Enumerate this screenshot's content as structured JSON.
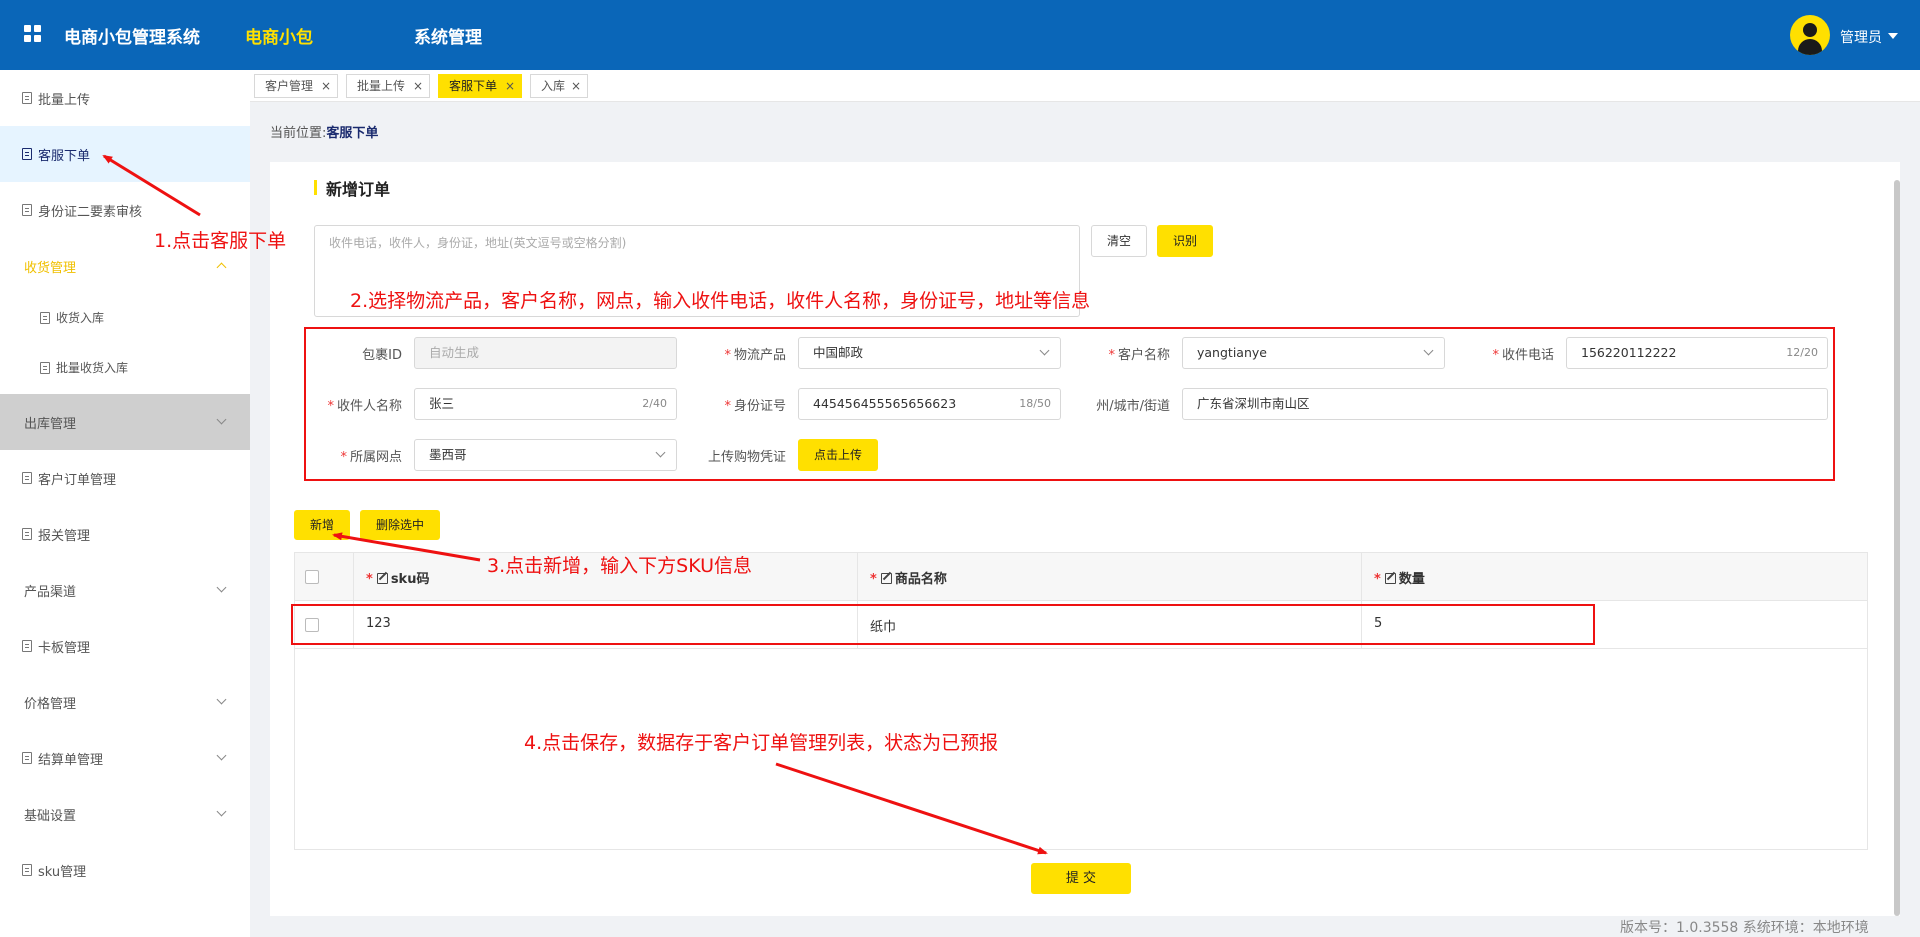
{
  "header": {
    "brand": "电商小包管理系统",
    "nav": [
      {
        "label": "电商小包",
        "active": true
      },
      {
        "label": "系统管理",
        "active": false
      }
    ],
    "user": "管理员"
  },
  "sidebar": {
    "items": [
      {
        "label": "批量上传"
      },
      {
        "label": "客服下单"
      },
      {
        "label": "身份证二要素审核"
      },
      {
        "label": "收货管理"
      },
      {
        "label": "收货入库"
      },
      {
        "label": "批量收货入库"
      },
      {
        "label": "出库管理"
      },
      {
        "label": "客户订单管理"
      },
      {
        "label": "报关管理"
      },
      {
        "label": "产品渠道"
      },
      {
        "label": "卡板管理"
      },
      {
        "label": "价格管理"
      },
      {
        "label": "结算单管理"
      },
      {
        "label": "基础设置"
      },
      {
        "label": "sku管理"
      }
    ]
  },
  "tabs": [
    {
      "label": "客户管理"
    },
    {
      "label": "批量上传"
    },
    {
      "label": "客服下单"
    },
    {
      "label": "入库"
    }
  ],
  "tab_close": "×",
  "breadcrumb": {
    "prefix": "当前位置:",
    "current": "客服下单"
  },
  "form": {
    "title": "新增订单",
    "paste_placeholder": "收件电话，收件人，身份证，地址(英文逗号或空格分割)",
    "clear_label": "清空",
    "recognize_label": "识别",
    "req_mark": "*",
    "fields": {
      "package_id": {
        "label": "包裹ID",
        "placeholder": "自动生成"
      },
      "product": {
        "label": "物流产品",
        "value": "中国邮政"
      },
      "customer": {
        "label": "客户名称",
        "value": "yangtianye"
      },
      "phone": {
        "label": "收件电话",
        "value": "156220112222",
        "count": "12/20"
      },
      "recipient": {
        "label": "收件人名称",
        "value": "张三",
        "count": "2/40"
      },
      "id_number": {
        "label": "身份证号",
        "value": "445456455565656623",
        "count": "18/50"
      },
      "address": {
        "label": "州/城市/街道",
        "value": "广东省深圳市南山区"
      },
      "branch": {
        "label": "所属网点",
        "value": "墨西哥"
      },
      "voucher": {
        "label": "上传购物凭证",
        "button": "点击上传"
      }
    }
  },
  "sku": {
    "add_label": "新增",
    "delete_label": "删除选中",
    "columns": [
      "sku码",
      "商品名称",
      "数量"
    ],
    "rows": [
      {
        "sku": "123",
        "name": "纸巾",
        "qty": "5"
      }
    ]
  },
  "submit_label": "提 交",
  "annotations": [
    "1.点击客服下单",
    "2.选择物流产品，客户名称，网点，输入收件电话，收件人名称，身份证号，地址等信息",
    "3.点击新增，输入下方SKU信息",
    "4.点击保存，数据存于客户订单管理列表，状态为已预报"
  ],
  "footer": "版本号：1.0.3558 系统环境：本地环境",
  "colors": {
    "header": "#0a66b8",
    "accent": "#ffe000",
    "annotation": "#ee1111"
  }
}
